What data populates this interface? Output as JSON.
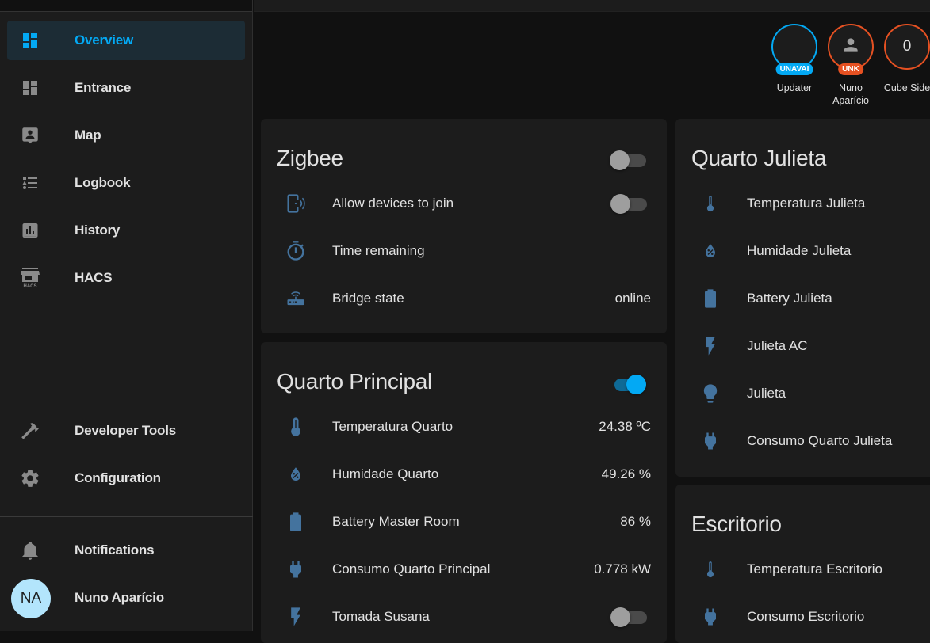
{
  "sidebar": {
    "items": [
      {
        "label": "Overview",
        "icon": "view-dashboard-icon",
        "active": true
      },
      {
        "label": "Entrance",
        "icon": "view-dashboard-icon",
        "active": false
      },
      {
        "label": "Map",
        "icon": "account-box-marker-icon",
        "active": false
      },
      {
        "label": "Logbook",
        "icon": "format-list-bulleted-type-icon",
        "active": false
      },
      {
        "label": "History",
        "icon": "chart-box-icon",
        "active": false
      },
      {
        "label": "HACS",
        "icon": "hacs-store-icon",
        "active": false
      }
    ],
    "bottom_items": [
      {
        "label": "Developer Tools",
        "icon": "hammer-icon"
      },
      {
        "label": "Configuration",
        "icon": "cog-icon"
      }
    ],
    "notifications_label": "Notifications",
    "user": {
      "name": "Nuno Aparício",
      "initials": "NA"
    }
  },
  "badges": [
    {
      "name": "Updater",
      "label": "UNAVAI",
      "value": "",
      "color": "#03a9f4"
    },
    {
      "name": "Nuno Aparício",
      "label": "UNK",
      "value": "",
      "icon": "account-icon",
      "color": "#e65122"
    },
    {
      "name": "Cube Side",
      "label": "",
      "value": "0",
      "color": "#e65122"
    }
  ],
  "cards": {
    "zigbee": {
      "title": "Zigbee",
      "toggle_on": false,
      "rows": [
        {
          "label": "Allow devices to join",
          "icon": "cellphone-wireless-icon",
          "toggle": false
        },
        {
          "label": "Time remaining",
          "icon": "timer-icon",
          "value": ""
        },
        {
          "label": "Bridge state",
          "icon": "router-wireless-icon",
          "value": "online"
        }
      ]
    },
    "quarto_principal": {
      "title": "Quarto Principal",
      "toggle_on": true,
      "rows": [
        {
          "label": "Temperatura Quarto",
          "icon": "thermometer-icon",
          "value": "24.38 ºC"
        },
        {
          "label": "Humidade Quarto",
          "icon": "water-percent-icon",
          "value": "49.26 %"
        },
        {
          "label": "Battery Master Room",
          "icon": "battery-icon",
          "value": "86 %"
        },
        {
          "label": "Consumo Quarto Principal",
          "icon": "power-plug-icon",
          "value": "0.778 kW"
        },
        {
          "label": "Tomada Susana",
          "icon": "flash-icon",
          "toggle": false
        }
      ]
    },
    "quarto_julieta": {
      "title": "Quarto Julieta",
      "rows": [
        {
          "label": "Temperatura Julieta",
          "icon": "thermometer-icon"
        },
        {
          "label": "Humidade Julieta",
          "icon": "water-percent-icon"
        },
        {
          "label": "Battery Julieta",
          "icon": "battery-icon"
        },
        {
          "label": "Julieta AC",
          "icon": "flash-icon"
        },
        {
          "label": "Julieta",
          "icon": "lightbulb-icon"
        },
        {
          "label": "Consumo Quarto Julieta",
          "icon": "power-plug-icon"
        }
      ]
    },
    "escritorio": {
      "title": "Escritorio",
      "rows": [
        {
          "label": "Temperatura Escritorio",
          "icon": "thermometer-icon"
        },
        {
          "label": "Consumo Escritorio",
          "icon": "power-plug-icon"
        }
      ]
    }
  },
  "colors": {
    "accent": "#03a9f4",
    "icon_state": "#44739e",
    "badge_unknown": "#e65122"
  }
}
